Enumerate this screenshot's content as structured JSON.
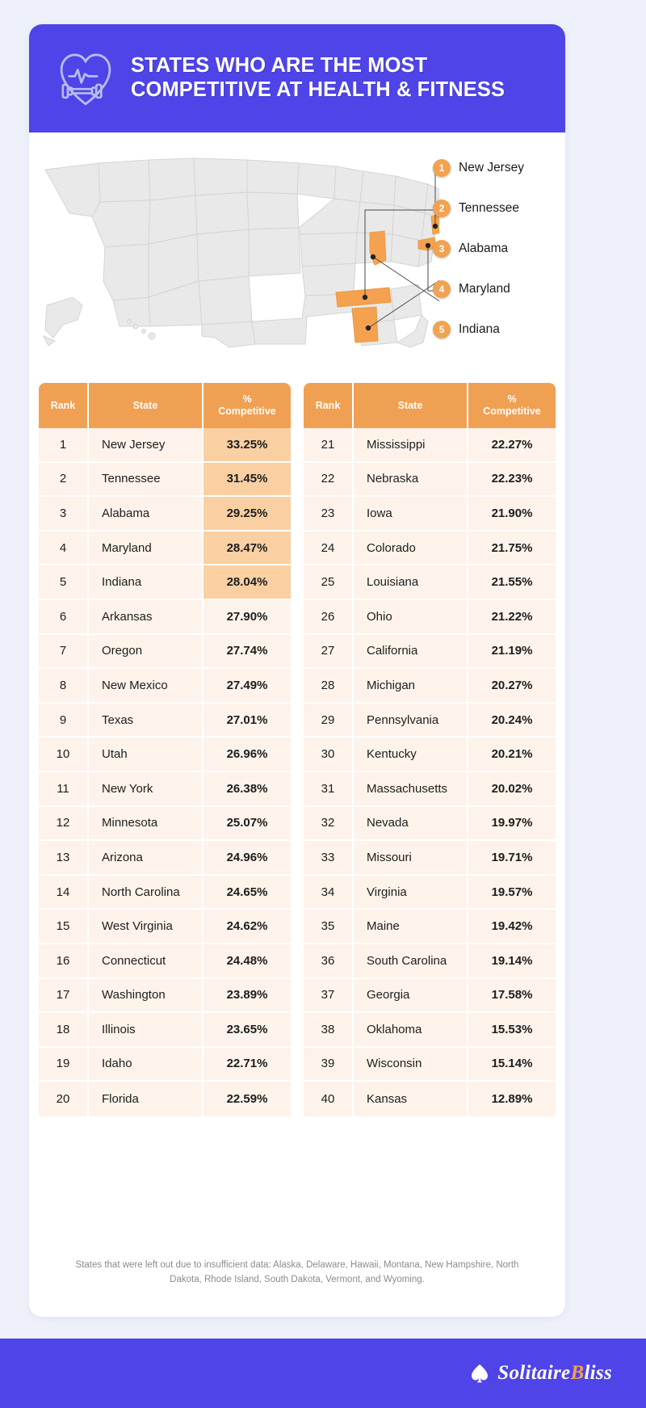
{
  "header": {
    "title": "STATES WHO ARE THE MOST COMPETITIVE AT HEALTH & FITNESS",
    "icon": "heart-dumbbell-icon",
    "background_color": "#4e44e8"
  },
  "map": {
    "callouts": [
      {
        "rank": "1",
        "state": "New Jersey"
      },
      {
        "rank": "2",
        "state": "Tennessee"
      },
      {
        "rank": "3",
        "state": "Alabama"
      },
      {
        "rank": "4",
        "state": "Maryland"
      },
      {
        "rank": "5",
        "state": "Indiana"
      }
    ],
    "highlight_color": "#f4a250",
    "base_color": "#e8e8e8"
  },
  "table": {
    "columns": [
      "Rank",
      "State",
      "% Competitive"
    ],
    "header_rank": "Rank",
    "header_state": "State",
    "header_pct_line1": "%",
    "header_pct_line2": "Competitive",
    "header_color": "#f0a052",
    "row_color": "#fdf3ea",
    "top5_highlight_color": "#fad0a2",
    "left_rows": [
      {
        "rank": "1",
        "state": "New Jersey",
        "pct": "33.25%",
        "top5": true
      },
      {
        "rank": "2",
        "state": "Tennessee",
        "pct": "31.45%",
        "top5": true
      },
      {
        "rank": "3",
        "state": "Alabama",
        "pct": "29.25%",
        "top5": true
      },
      {
        "rank": "4",
        "state": "Maryland",
        "pct": "28.47%",
        "top5": true
      },
      {
        "rank": "5",
        "state": "Indiana",
        "pct": "28.04%",
        "top5": true
      },
      {
        "rank": "6",
        "state": "Arkansas",
        "pct": "27.90%",
        "top5": false
      },
      {
        "rank": "7",
        "state": "Oregon",
        "pct": "27.74%",
        "top5": false
      },
      {
        "rank": "8",
        "state": "New Mexico",
        "pct": "27.49%",
        "top5": false
      },
      {
        "rank": "9",
        "state": "Texas",
        "pct": "27.01%",
        "top5": false
      },
      {
        "rank": "10",
        "state": "Utah",
        "pct": "26.96%",
        "top5": false
      },
      {
        "rank": "11",
        "state": "New York",
        "pct": "26.38%",
        "top5": false
      },
      {
        "rank": "12",
        "state": "Minnesota",
        "pct": "25.07%",
        "top5": false
      },
      {
        "rank": "13",
        "state": "Arizona",
        "pct": "24.96%",
        "top5": false
      },
      {
        "rank": "14",
        "state": "North Carolina",
        "pct": "24.65%",
        "top5": false
      },
      {
        "rank": "15",
        "state": "West Virginia",
        "pct": "24.62%",
        "top5": false
      },
      {
        "rank": "16",
        "state": "Connecticut",
        "pct": "24.48%",
        "top5": false
      },
      {
        "rank": "17",
        "state": "Washington",
        "pct": "23.89%",
        "top5": false
      },
      {
        "rank": "18",
        "state": "Illinois",
        "pct": "23.65%",
        "top5": false
      },
      {
        "rank": "19",
        "state": "Idaho",
        "pct": "22.71%",
        "top5": false
      },
      {
        "rank": "20",
        "state": "Florida",
        "pct": "22.59%",
        "top5": false
      }
    ],
    "right_rows": [
      {
        "rank": "21",
        "state": "Mississippi",
        "pct": "22.27%",
        "top5": false
      },
      {
        "rank": "22",
        "state": "Nebraska",
        "pct": "22.23%",
        "top5": false
      },
      {
        "rank": "23",
        "state": "Iowa",
        "pct": "21.90%",
        "top5": false
      },
      {
        "rank": "24",
        "state": "Colorado",
        "pct": "21.75%",
        "top5": false
      },
      {
        "rank": "25",
        "state": "Louisiana",
        "pct": "21.55%",
        "top5": false
      },
      {
        "rank": "26",
        "state": "Ohio",
        "pct": "21.22%",
        "top5": false
      },
      {
        "rank": "27",
        "state": "California",
        "pct": "21.19%",
        "top5": false
      },
      {
        "rank": "28",
        "state": "Michigan",
        "pct": "20.27%",
        "top5": false
      },
      {
        "rank": "29",
        "state": "Pennsylvania",
        "pct": "20.24%",
        "top5": false
      },
      {
        "rank": "30",
        "state": "Kentucky",
        "pct": "20.21%",
        "top5": false
      },
      {
        "rank": "31",
        "state": "Massachusetts",
        "pct": "20.02%",
        "top5": false
      },
      {
        "rank": "32",
        "state": "Nevada",
        "pct": "19.97%",
        "top5": false
      },
      {
        "rank": "33",
        "state": "Missouri",
        "pct": "19.71%",
        "top5": false
      },
      {
        "rank": "34",
        "state": "Virginia",
        "pct": "19.57%",
        "top5": false
      },
      {
        "rank": "35",
        "state": "Maine",
        "pct": "19.42%",
        "top5": false
      },
      {
        "rank": "36",
        "state": "South Carolina",
        "pct": "19.14%",
        "top5": false
      },
      {
        "rank": "37",
        "state": "Georgia",
        "pct": "17.58%",
        "top5": false
      },
      {
        "rank": "38",
        "state": "Oklahoma",
        "pct": "15.53%",
        "top5": false
      },
      {
        "rank": "39",
        "state": "Wisconsin",
        "pct": "15.14%",
        "top5": false
      },
      {
        "rank": "40",
        "state": "Kansas",
        "pct": "12.89%",
        "top5": false
      }
    ]
  },
  "footnote": {
    "line1": "States that were left out due to insufficient data: Alaska, Delaware, Hawaii, Montana, New Hampshire,",
    "line2": "North Dakota, Rhode Island, South Dakota, Vermont, and Wyoming."
  },
  "footer": {
    "logo_name_part1": "Solitaire",
    "logo_name_part2": "B",
    "logo_name_part3": "liss",
    "background_color": "#4e44e8"
  },
  "chart_data": {
    "type": "table",
    "title": "States Who Are The Most Competitive At Health & Fitness",
    "xlabel": "State",
    "ylabel": "% Competitive",
    "categories": [
      "New Jersey",
      "Tennessee",
      "Alabama",
      "Maryland",
      "Indiana",
      "Arkansas",
      "Oregon",
      "New Mexico",
      "Texas",
      "Utah",
      "New York",
      "Minnesota",
      "Arizona",
      "North Carolina",
      "West Virginia",
      "Connecticut",
      "Washington",
      "Illinois",
      "Idaho",
      "Florida",
      "Mississippi",
      "Nebraska",
      "Iowa",
      "Colorado",
      "Louisiana",
      "Ohio",
      "California",
      "Michigan",
      "Pennsylvania",
      "Kentucky",
      "Massachusetts",
      "Nevada",
      "Missouri",
      "Virginia",
      "Maine",
      "South Carolina",
      "Georgia",
      "Oklahoma",
      "Wisconsin",
      "Kansas"
    ],
    "values": [
      33.25,
      31.45,
      29.25,
      28.47,
      28.04,
      27.9,
      27.74,
      27.49,
      27.01,
      26.96,
      26.38,
      25.07,
      24.96,
      24.65,
      24.62,
      24.48,
      23.89,
      23.65,
      22.71,
      22.59,
      22.27,
      22.23,
      21.9,
      21.75,
      21.55,
      21.22,
      21.19,
      20.27,
      20.24,
      20.21,
      20.02,
      19.97,
      19.71,
      19.57,
      19.42,
      19.14,
      17.58,
      15.53,
      15.14,
      12.89
    ],
    "unit": "%",
    "ylim": [
      0,
      35
    ],
    "highlighted": [
      "New Jersey",
      "Tennessee",
      "Alabama",
      "Maryland",
      "Indiana"
    ],
    "excluded_states": [
      "Alaska",
      "Delaware",
      "Hawaii",
      "Montana",
      "New Hampshire",
      "North Dakota",
      "Rhode Island",
      "South Dakota",
      "Vermont",
      "Wyoming"
    ]
  }
}
